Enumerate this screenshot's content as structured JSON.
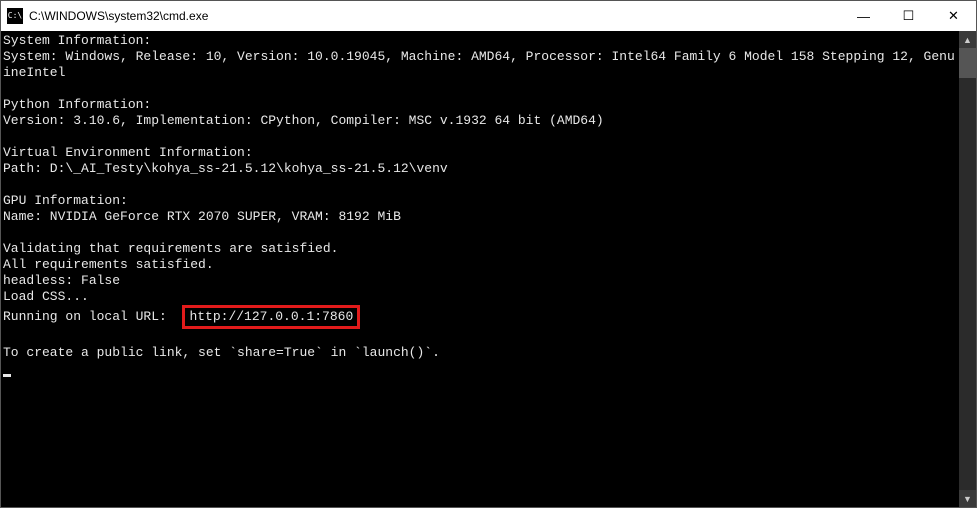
{
  "window": {
    "title": "C:\\WINDOWS\\system32\\cmd.exe",
    "icon_label": "C:\\"
  },
  "controls": {
    "minimize": "—",
    "maximize": "☐",
    "close": "✕"
  },
  "scroll": {
    "up": "▲",
    "down": "▼"
  },
  "terminal": {
    "lines": [
      "System Information:",
      "System: Windows, Release: 10, Version: 10.0.19045, Machine: AMD64, Processor: Intel64 Family 6 Model 158 Stepping 12, GenuineIntel",
      "",
      "Python Information:",
      "Version: 3.10.6, Implementation: CPython, Compiler: MSC v.1932 64 bit (AMD64)",
      "",
      "Virtual Environment Information:",
      "Path: D:\\_AI_Testy\\kohya_ss-21.5.12\\kohya_ss-21.5.12\\venv",
      "",
      "GPU Information:",
      "Name: NVIDIA GeForce RTX 2070 SUPER, VRAM: 8192 MiB",
      "",
      "Validating that requirements are satisfied.",
      "All requirements satisfied.",
      "headless: False",
      "Load CSS..."
    ],
    "running_prefix": "Running on local URL:  ",
    "running_url": "http://127.0.0.1:7860",
    "blank_after_url": "",
    "footer_line": "To create a public link, set `share=True` in `launch()`."
  }
}
